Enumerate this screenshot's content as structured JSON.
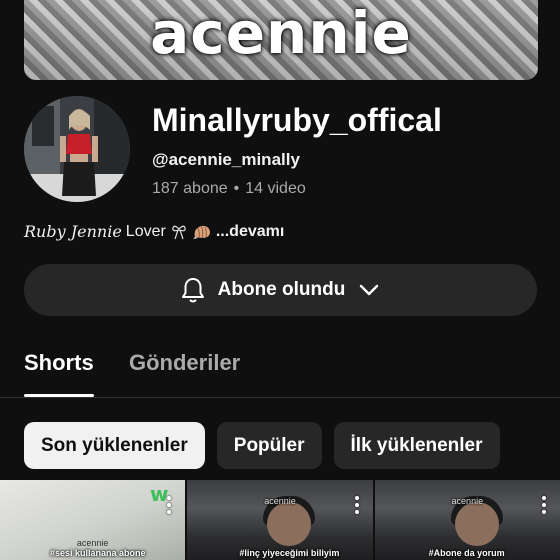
{
  "banner": {
    "text": "acennie"
  },
  "channel": {
    "name": "Minallyruby_offical",
    "handle": "@acennie_minally",
    "subscribers": "187 abone",
    "separator": "•",
    "videos": "14 video"
  },
  "description": {
    "script_text": "Ruby Jennie",
    "text": " Lover",
    "more": "...devamı"
  },
  "subscribe_button": {
    "label": "Abone olundu"
  },
  "tabs": [
    {
      "label": "Shorts"
    },
    {
      "label": "Gönderiler"
    }
  ],
  "chips": [
    {
      "label": "Son yüklenenler"
    },
    {
      "label": "Popüler"
    },
    {
      "label": "İlk yüklenenler"
    }
  ],
  "thumbnails": [
    {
      "watermark": "acennie",
      "caption": "#sesi kullanana abone"
    },
    {
      "watermark": "acennie",
      "caption": "#linç yiyeceğimi biliyim"
    },
    {
      "watermark": "acennie",
      "caption": "#Abone da yorum"
    }
  ],
  "colors": {
    "background": "#0f0f0f",
    "button": "#272727",
    "secondary_text": "#aaaaaa"
  }
}
